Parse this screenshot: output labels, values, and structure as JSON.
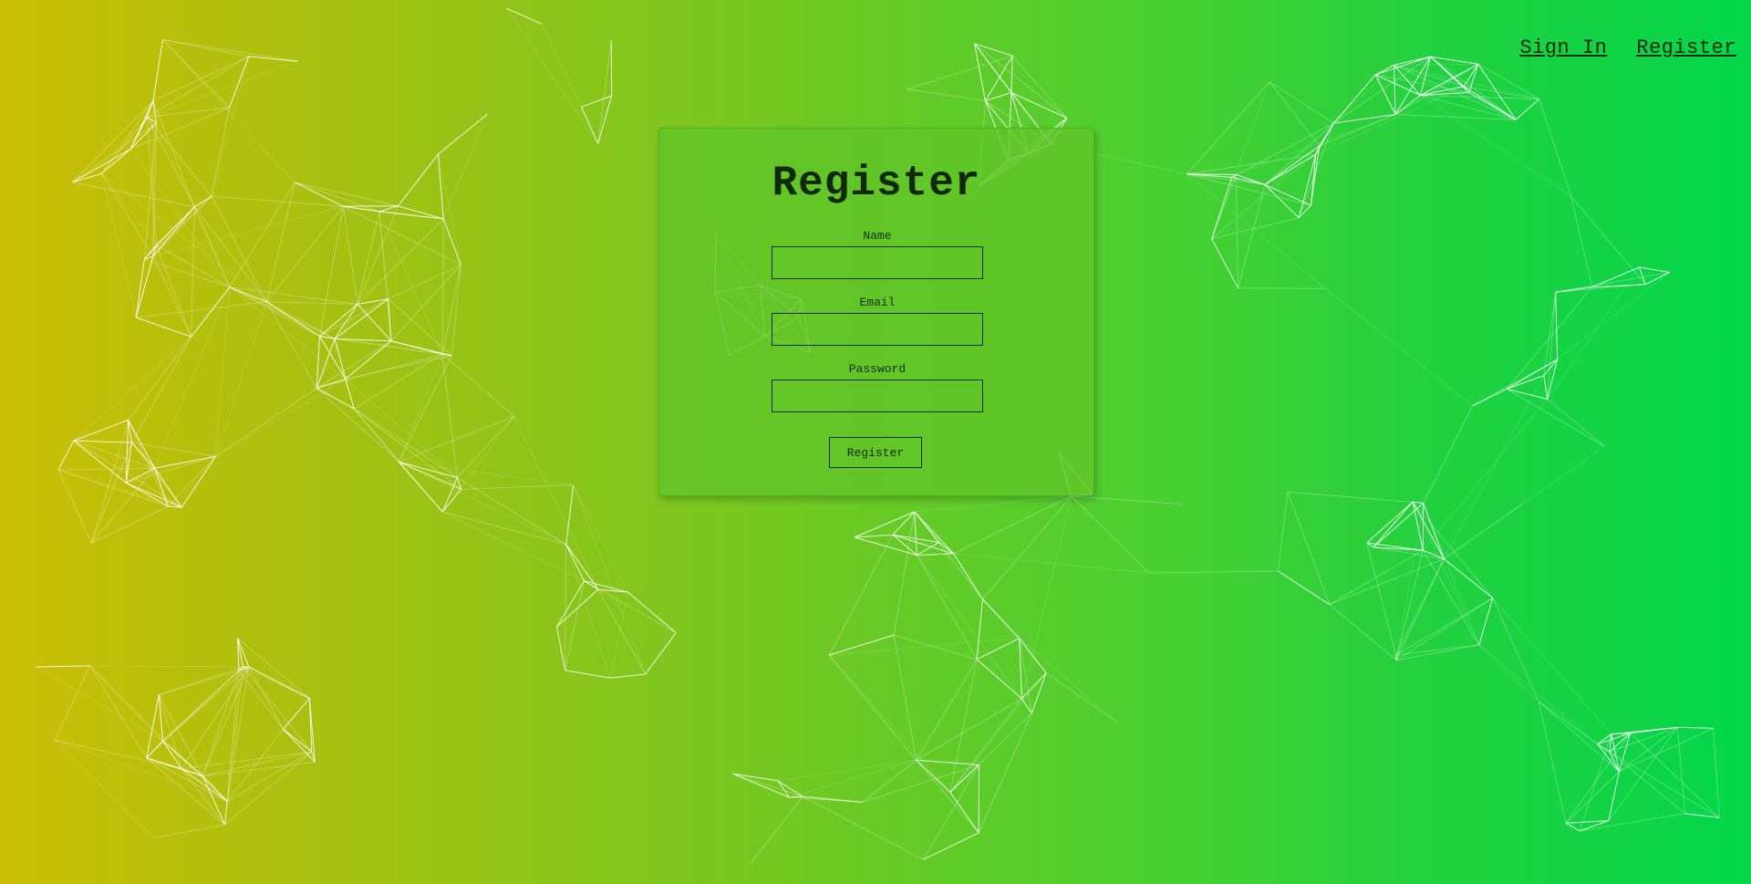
{
  "nav": {
    "sign_in": "Sign In",
    "register": "Register"
  },
  "form": {
    "title": "Register",
    "name_label": "Name",
    "name_value": "",
    "email_label": "Email",
    "email_value": "",
    "password_label": "Password",
    "password_value": "",
    "submit_label": "Register"
  },
  "colors": {
    "gradient_start": "#cbbf05",
    "gradient_end": "#03d64a",
    "card": "#60c428",
    "text": "#10290b"
  }
}
